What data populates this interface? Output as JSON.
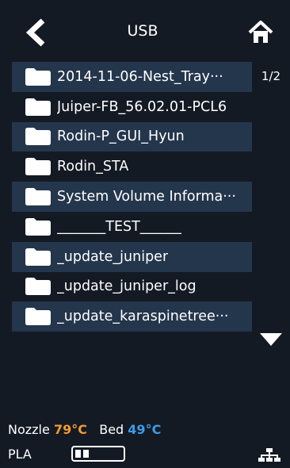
{
  "header": {
    "title": "USB"
  },
  "page_indicator": "1/2",
  "files": [
    {
      "name": "2014-11-06-Nest_Tray···"
    },
    {
      "name": "Juiper-FB_56.02.01-PCL6"
    },
    {
      "name": "Rodin-P_GUI_Hyun"
    },
    {
      "name": "Rodin_STA"
    },
    {
      "name": "System Volume Informa···"
    },
    {
      "name": "_______TEST______"
    },
    {
      "name": "_update_juniper"
    },
    {
      "name": "_update_juniper_log"
    },
    {
      "name": "_update_karaspinetree···"
    }
  ],
  "status": {
    "nozzle_label": "Nozzle",
    "nozzle_temp": "79°C",
    "bed_label": "Bed",
    "bed_temp": "49°C",
    "material": "PLA",
    "filament_level": 0.2
  },
  "colors": {
    "row_alt": "#24364c",
    "background": "#141a24",
    "nozzle_temp": "#f29a2e",
    "bed_temp": "#3d9be9"
  },
  "icons": {
    "back": "chevron-left-icon",
    "home": "home-icon",
    "folder": "folder-icon",
    "scroll_down": "triangle-down-icon",
    "network": "network-icon"
  }
}
